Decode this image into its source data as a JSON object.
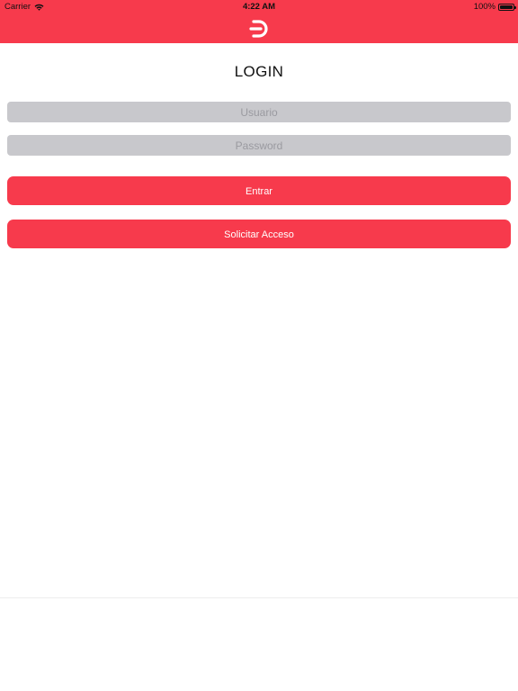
{
  "status_bar": {
    "carrier": "Carrier",
    "time": "4:22 AM",
    "battery": "100%"
  },
  "header": {
    "logo_icon": "brand-d-logo-icon",
    "accent_color": "#f73a4c"
  },
  "login": {
    "title": "LOGIN",
    "username_placeholder": "Usuario",
    "password_placeholder": "Password",
    "submit_label": "Entrar",
    "request_access_label": "Solicitar Acceso"
  }
}
